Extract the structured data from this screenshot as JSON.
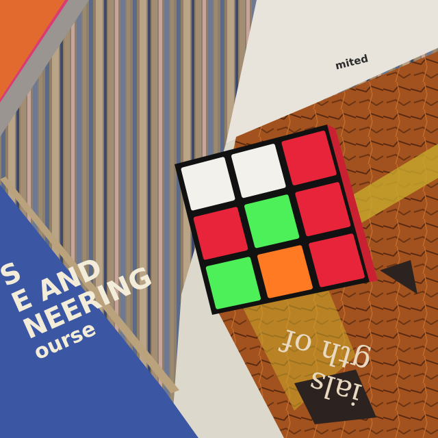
{
  "scene": {
    "blue_book": {
      "lines": [
        "S",
        "E AND",
        "NEERING",
        "ourse"
      ]
    },
    "orange_book": {
      "lines": [
        "ials",
        "gth of"
      ]
    },
    "paper": {
      "label": "mited"
    },
    "cube": {
      "face_colors": [
        [
          "white",
          "white",
          "red"
        ],
        [
          "red",
          "green",
          "red"
        ],
        [
          "green",
          "orange",
          "red"
        ]
      ],
      "palette": {
        "white": "#f2f1ec",
        "red": "#e8243a",
        "green": "#4ef05a",
        "orange": "#ff7a22"
      }
    }
  }
}
